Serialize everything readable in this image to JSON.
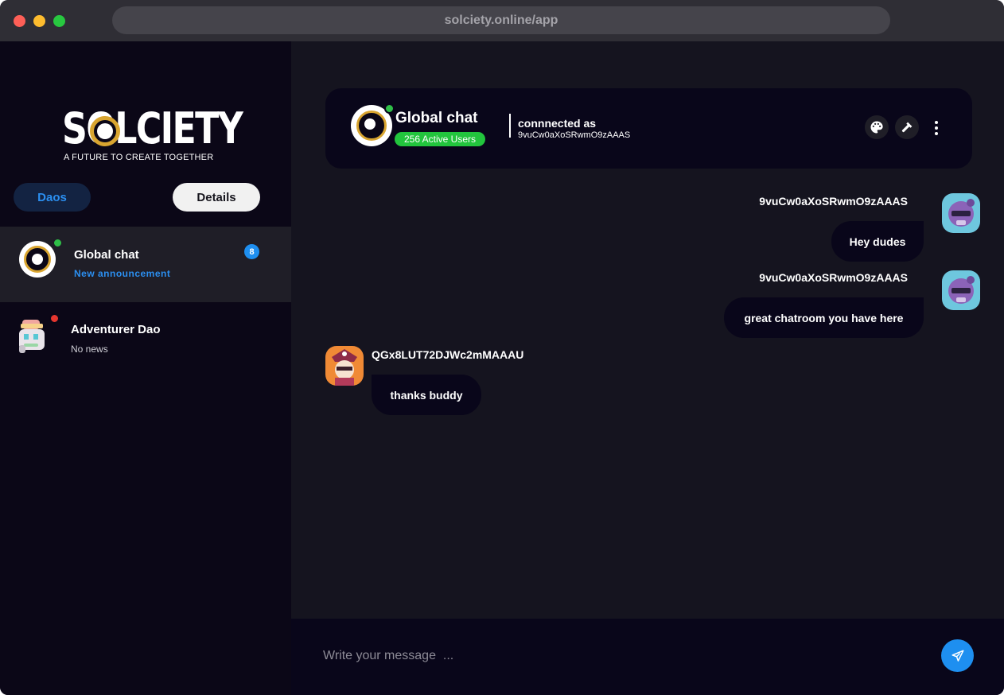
{
  "browser": {
    "url": "solciety.online/app"
  },
  "brand": {
    "wordmark": "SOLCIETY",
    "tagline": "A FUTURE TO CREATE TOGETHER",
    "accent": "#d9a530"
  },
  "sidebar": {
    "tabs": [
      {
        "label": "Daos",
        "selected": false
      },
      {
        "label": "Details",
        "selected": true
      }
    ],
    "chats": [
      {
        "title": "Global chat",
        "subtitle": "New announcement",
        "badge": "8",
        "status": "online",
        "active": true
      },
      {
        "title": "Adventurer Dao",
        "subtitle": "No news",
        "status": "offline",
        "active": false
      }
    ]
  },
  "header": {
    "title": "Global chat",
    "active_users": "256 Active Users",
    "connected_label": "connnected as",
    "connected_id": "9vuCw0aXoSRwmO9zAAAS",
    "actions": [
      {
        "icon": "palette-icon"
      },
      {
        "icon": "hammer-icon"
      },
      {
        "icon": "kebab-menu-icon"
      }
    ]
  },
  "messages": [
    {
      "author": "9vuCw0aXoSRwmO9zAAAS",
      "text": "Hey dudes",
      "side": "right"
    },
    {
      "author": "9vuCw0aXoSRwmO9zAAAS",
      "text": "great chatroom you have here",
      "side": "right"
    },
    {
      "author": "QGx8LUT72DJWc2mMAAAU",
      "text": "thanks buddy",
      "side": "left"
    }
  ],
  "composer": {
    "placeholder": "Write your message  ...",
    "value": ""
  },
  "colors": {
    "primary": "#1e8ff0",
    "online": "#2fbe48",
    "offline": "#e5362f",
    "active_pill": "#22c53d"
  }
}
